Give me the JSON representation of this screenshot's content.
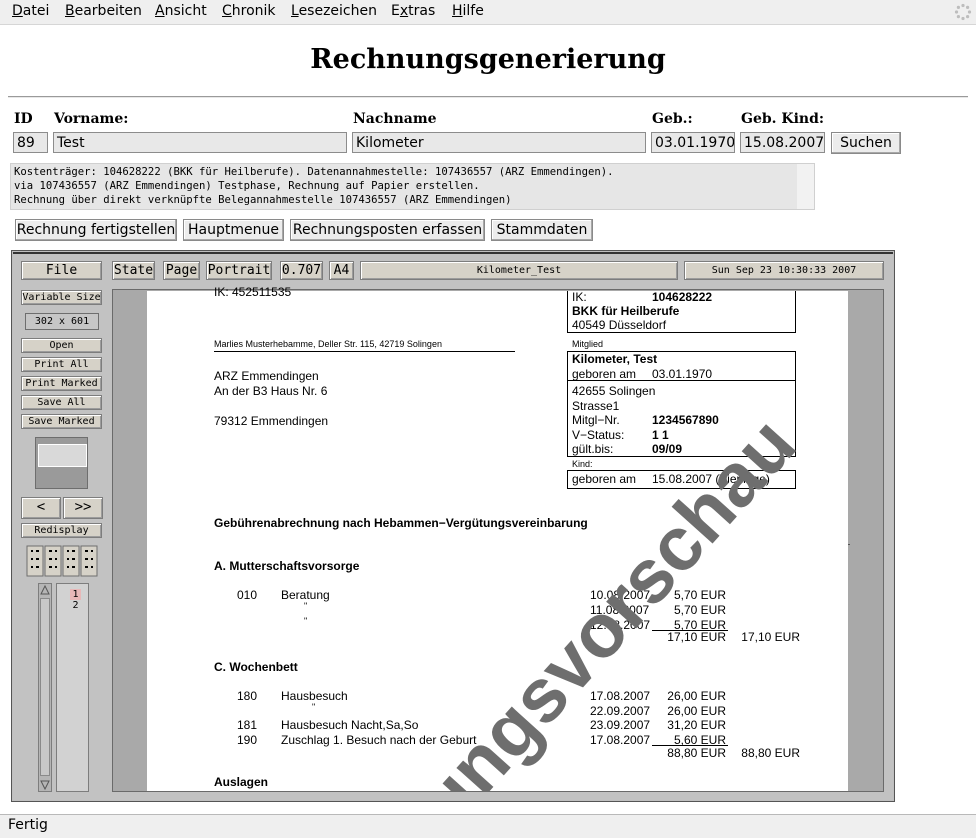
{
  "menubar": {
    "items": [
      {
        "label": "Datei",
        "accel": "D"
      },
      {
        "label": "Bearbeiten",
        "accel": "B"
      },
      {
        "label": "Ansicht",
        "accel": "A"
      },
      {
        "label": "Chronik",
        "accel": "C"
      },
      {
        "label": "Lesezeichen",
        "accel": "L"
      },
      {
        "label": "Extras",
        "accel": "x"
      },
      {
        "label": "Hilfe",
        "accel": "H"
      }
    ],
    "throbber_icon": "spinner-icon"
  },
  "page": {
    "title": "Rechnungsgenerierung"
  },
  "search_form": {
    "labels": {
      "id": "ID",
      "vorname": "Vorname:",
      "nachname": "Nachname",
      "geb": "Geb.:",
      "geb_kind": "Geb. Kind:"
    },
    "values": {
      "id": "89",
      "vorname": "Test",
      "nachname": "Kilometer",
      "geb": "03.01.1970",
      "geb_kind": "15.08.2007"
    },
    "search_button": "Suchen"
  },
  "info": {
    "lines": [
      "Kostenträger: 104628222 (BKK für Heilberufe). Datenannahmestelle: 107436557 (ARZ Emmendingen).",
      "via 107436557 (ARZ Emmendingen) Testphase, Rechnung auf Papier erstellen.",
      "Rechnung über direkt verknüpfte Belegannahmestelle 107436557 (ARZ Emmendingen)"
    ]
  },
  "actions": {
    "finish": "Rechnung fertigstellen",
    "main_menu": "Hauptmenue",
    "add_items": "Rechnungsposten erfassen",
    "master_data": "Stammdaten"
  },
  "viewer": {
    "file": "File",
    "state": "State",
    "page": "Page",
    "orientation": "Portrait",
    "zoom": "0.707",
    "paper_size": "A4",
    "document_name": "Kilometer_Test",
    "datetime": "Sun Sep 23 10:30:33 2007",
    "variable_size": "Variable Size",
    "size_readout": "302 x 601",
    "open": "Open",
    "print_all": "Print All",
    "print_marked": "Print Marked",
    "save_all": "Save All",
    "save_marked": "Save Marked",
    "prev": "<",
    "next": ">>",
    "redisplay": "Redisplay",
    "pages": [
      "1",
      "2"
    ]
  },
  "document": {
    "ik_partial": "IK: 452511535",
    "insurer_ik_label": "IK:",
    "insurer_ik": "104628222",
    "insurer_name": "BKK für Heilberufe",
    "insurer_city": "40549 Düsseldorf",
    "sender_line": "Marlies Musterhebamme, Deller Str. 115, 42719 Solingen",
    "recipient": [
      "ARZ Emmendingen",
      "An der B3 Haus Nr. 6",
      "79312 Emmendingen"
    ],
    "mitglied_label": "Mitglied",
    "member_name": "Kilometer, Test",
    "born_label": "geboren am",
    "member_born": "03.01.1970",
    "member_city": "42655 Solingen",
    "member_street": "Strasse1",
    "mitgl_nr_label": "Mitgl−Nr.",
    "mitgl_nr": "1234567890",
    "v_status_label": "V−Status:",
    "v_status": "1 1",
    "gueltig_label": "gült.bis:",
    "gueltig": "09/09",
    "kind_label": "Kind:",
    "child_born_label": "geboren am",
    "child_born": "15.08.2007 (Vierlinge)",
    "heading": "Gebührenabrechnung nach Hebammen−Vergütungsvereinbarung",
    "section_a": "A. Mutterschaftsvorsorge",
    "section_a_rows": [
      {
        "code": "010",
        "desc": "Beratung",
        "date": "10.08.2007",
        "amount": "5,70 EUR"
      },
      {
        "code": "",
        "desc": "\"",
        "date": "11.08.2007",
        "amount": "5,70 EUR"
      },
      {
        "code": "",
        "desc": "\"",
        "date": "12.08.2007",
        "amount": "5,70 EUR"
      }
    ],
    "section_a_subtotal": "17,10 EUR",
    "section_a_total": "17,10 EUR",
    "section_c": "C. Wochenbett",
    "section_c_rows": [
      {
        "code": "180",
        "desc": "Hausbesuch",
        "date": "17.08.2007",
        "amount": "26,00 EUR"
      },
      {
        "code": "",
        "desc": "\"",
        "date": "22.09.2007",
        "amount": "26,00 EUR"
      },
      {
        "code": "181",
        "desc": "Hausbesuch Nacht,Sa,So",
        "date": "23.09.2007",
        "amount": "31,20 EUR"
      },
      {
        "code": "190",
        "desc": "Zuschlag 1. Besuch nach der Geburt",
        "date": "17.08.2007",
        "amount": "5,60 EUR"
      }
    ],
    "section_c_subtotal": "88,80 EUR",
    "section_c_total": "88,80 EUR",
    "section_auslagen": "Auslagen",
    "watermark": "ungsvorschau"
  },
  "status": {
    "text": "Fertig"
  }
}
